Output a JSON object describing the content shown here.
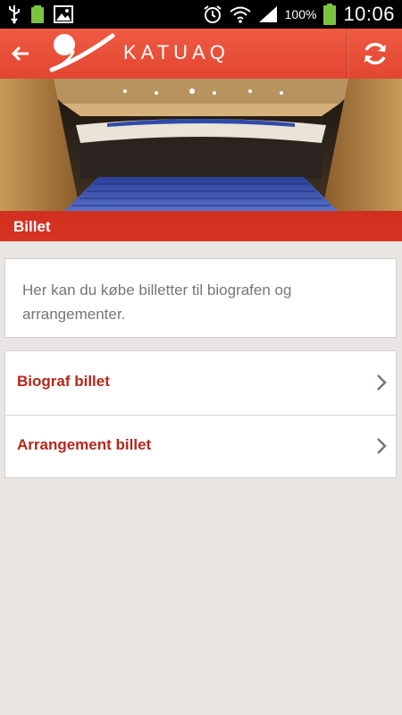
{
  "status_bar": {
    "battery_percent": "100%",
    "time": "10:06",
    "icons": [
      "usb-icon",
      "battery-small-icon",
      "image-icon",
      "alarm-icon",
      "wifi-icon",
      "signal-icon",
      "battery-icon"
    ]
  },
  "app_bar": {
    "brand": "KATUAQ",
    "back_icon": "arrow-left-icon",
    "refresh_icon": "refresh-icon",
    "color": "#e84c36"
  },
  "hero": {
    "section_label": "Billet"
  },
  "intro": {
    "text": "Her kan du købe billetter til biografen og arrangementer."
  },
  "menu": {
    "items": [
      {
        "label": "Biograf billet"
      },
      {
        "label": "Arrangement billet"
      }
    ],
    "label_color": "#b5271a"
  }
}
